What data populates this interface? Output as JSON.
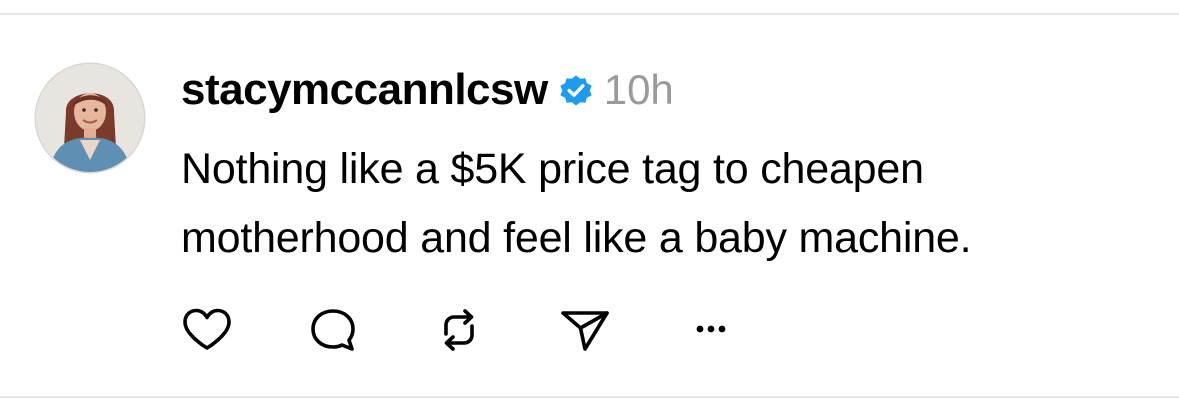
{
  "post": {
    "username": "stacymccannlcsw",
    "verified": true,
    "timestamp": "10h",
    "text_lines": [
      "Nothing like a $5K price tag to cheapen",
      "motherhood and feel like a baby machine."
    ]
  },
  "icons": {
    "avatar": "profile-photo",
    "verified": "verified-badge-icon",
    "like": "heart-icon",
    "reply": "comment-bubble-icon",
    "repost": "repost-arrows-icon",
    "share": "send-paper-plane-icon",
    "more": "more-dots-icon"
  },
  "colors": {
    "verified_badge": "#1d9bf0",
    "timestamp": "#9a9a9a",
    "icon_stroke": "#000000",
    "divider": "#e6e6e6"
  }
}
